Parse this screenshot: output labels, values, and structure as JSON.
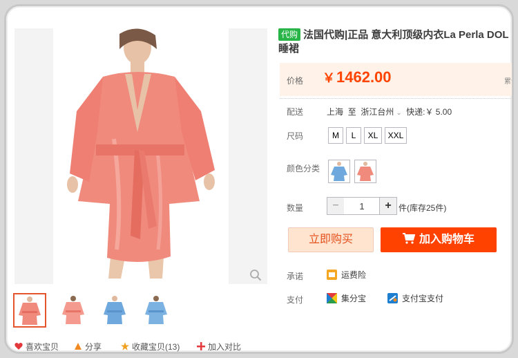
{
  "product": {
    "tag": "代购",
    "title_line1": "法国代购|正品 意大利顶级内衣La Perla DOL",
    "title_line2": "睡裙"
  },
  "price": {
    "label": "价格",
    "currency": "￥",
    "value": "1462.00",
    "edge_note_line1": "(",
    "edge_note_line2": "累计"
  },
  "delivery": {
    "label": "配送",
    "from": "上海",
    "to_word": "至",
    "destination": "浙江台州",
    "shipping": "快递:￥ 5.00"
  },
  "size": {
    "label": "尺码",
    "options": [
      "M",
      "L",
      "XL",
      "XXL"
    ]
  },
  "color": {
    "label": "颜色分类",
    "options": [
      "blue-robe-swatch",
      "pink-robe-swatch"
    ]
  },
  "quantity": {
    "label": "数量",
    "minus": "−",
    "value": "1",
    "plus": "+",
    "stock": "件(库存25件)"
  },
  "actions": {
    "buy_now": "立即购买",
    "add_to_cart": "加入购物车"
  },
  "promise": {
    "label": "承诺",
    "item": "运费险"
  },
  "payment": {
    "label": "支付",
    "items": [
      "集分宝",
      "支付宝支付"
    ]
  },
  "share_bar": {
    "items": [
      "喜欢宝贝",
      "分享",
      "收藏宝贝(13)",
      "加入对比"
    ]
  },
  "colors": {
    "price": "#ff4400",
    "cart_button": "#ff4200",
    "buy_button_bg": "#ffe4d0",
    "tag_green": "#28b447",
    "robe_pink": "#f0897c",
    "robe_blue": "#6fa8dc"
  }
}
